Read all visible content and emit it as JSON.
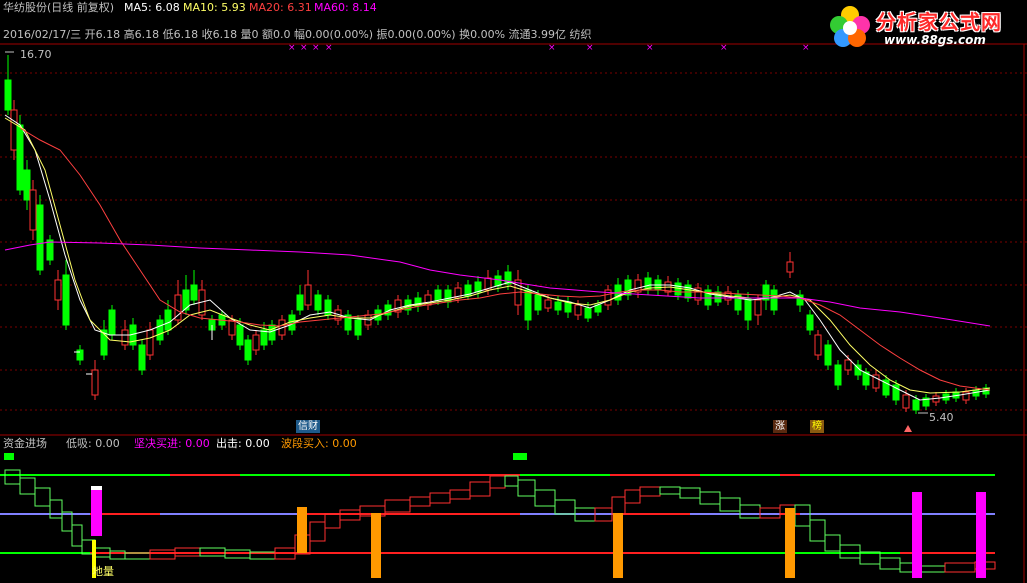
{
  "header": {
    "stock": "华纺股份(日线 前复权)",
    "ma5": "MA5: 6.08",
    "ma10": "MA10: 5.93",
    "ma20": "MA20: 6.31",
    "ma60": "MA60: 8.14"
  },
  "info_line": "2016/02/17/三 开6.18 高6.18 低6.18 收6.18 量0 额0.0 幅0.00(0.00%) 振0.00(0.00%) 换0.00% 流通3.99亿 纺织",
  "price_labels": {
    "high": "16.70",
    "low": "5.40"
  },
  "markers": {
    "finance": "信财",
    "rise": "涨",
    "board": "榜"
  },
  "indicator": {
    "name": "资金进场",
    "low_buy": "低吸: 0.00",
    "firm_buy": "坚决买进: 0.00",
    "exit": "出击: 0.00",
    "wave_buy": "波段买入: 0.00",
    "bottom_label": "地量"
  },
  "logo": {
    "title": "分析家公式网",
    "url": "www.88gs.com"
  },
  "colors": {
    "up": "#ff3232",
    "down": "#00ff00",
    "ma5": "#ffffff",
    "ma10": "#ffff66",
    "ma20": "#ff4040",
    "ma60": "#ff00ff",
    "grid": "#7a0000",
    "orange": "#ff9900",
    "magenta": "#ff00ff"
  }
}
